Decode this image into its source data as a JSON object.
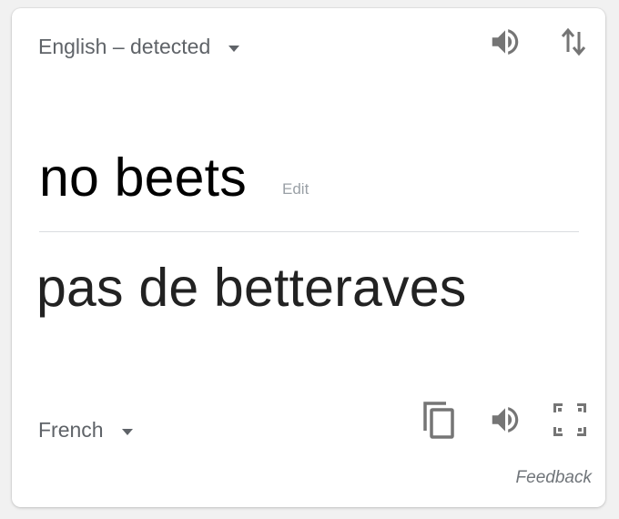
{
  "source": {
    "language_label": "English – detected",
    "text": "no beets",
    "edit_label": "Edit"
  },
  "target": {
    "language_label": "French",
    "text": "pas de betteraves"
  },
  "footer": {
    "feedback_label": "Feedback"
  },
  "icons": {
    "source_speaker": "speaker-icon",
    "swap": "swap-languages-icon",
    "copy": "copy-icon",
    "target_speaker": "speaker-icon",
    "fullscreen": "fullscreen-icon"
  },
  "colors": {
    "icon": "#757575",
    "muted_text": "#5f6368",
    "edit_text": "#9aa0a6",
    "divider": "#dadce0"
  }
}
